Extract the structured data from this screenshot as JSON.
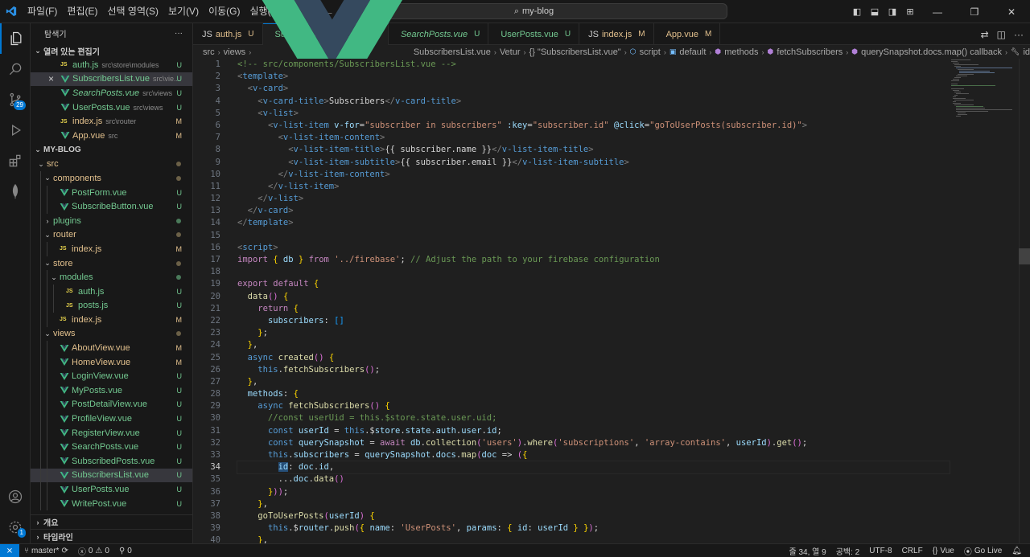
{
  "menu": [
    "파일(F)",
    "편집(E)",
    "선택 영역(S)",
    "보기(V)",
    "이동(G)",
    "실행(R)",
    "···"
  ],
  "search": {
    "label": "my-blog"
  },
  "explorer": {
    "title": "탐색기",
    "open_editors_label": "열려 있는 편집기",
    "open_editors": [
      {
        "kind": "js",
        "name": "auth.js",
        "path": "src\\store\\modules",
        "status": "U"
      },
      {
        "kind": "vue",
        "name": "SubscribersList.vue",
        "path": "src\\vie...",
        "status": "U",
        "close": "×"
      },
      {
        "kind": "vue",
        "name": "SearchPosts.vue",
        "path": "src\\views",
        "status": "U"
      },
      {
        "kind": "vue",
        "name": "UserPosts.vue",
        "path": "src\\views",
        "status": "U"
      },
      {
        "kind": "js",
        "name": "index.js",
        "path": "src\\router",
        "status": "M"
      },
      {
        "kind": "vue",
        "name": "App.vue",
        "path": "src",
        "status": "M"
      }
    ],
    "project_label": "MY-BLOG",
    "tree": [
      {
        "kind": "folder",
        "name": "src",
        "depth": 1,
        "open": true,
        "status": "dot"
      },
      {
        "kind": "folder",
        "name": "components",
        "depth": 2,
        "open": true,
        "status": "dot"
      },
      {
        "kind": "vue",
        "name": "PostForm.vue",
        "depth": 3,
        "status": "U"
      },
      {
        "kind": "vue",
        "name": "SubscribeButton.vue",
        "depth": 3,
        "status": "U"
      },
      {
        "kind": "folder",
        "name": "plugins",
        "depth": 2,
        "open": false,
        "status": "dotg"
      },
      {
        "kind": "folder",
        "name": "router",
        "depth": 2,
        "open": true,
        "status": "dot"
      },
      {
        "kind": "js",
        "name": "index.js",
        "depth": 3,
        "status": "M"
      },
      {
        "kind": "folder",
        "name": "store",
        "depth": 2,
        "open": true,
        "status": "dot"
      },
      {
        "kind": "folder",
        "name": "modules",
        "depth": 3,
        "open": true,
        "status": "dotg"
      },
      {
        "kind": "js",
        "name": "auth.js",
        "depth": 4,
        "status": "U"
      },
      {
        "kind": "js",
        "name": "posts.js",
        "depth": 4,
        "status": "U"
      },
      {
        "kind": "js",
        "name": "index.js",
        "depth": 3,
        "status": "M"
      },
      {
        "kind": "folder",
        "name": "views",
        "depth": 2,
        "open": true,
        "status": "dot"
      },
      {
        "kind": "vue",
        "name": "AboutView.vue",
        "depth": 3,
        "status": "M"
      },
      {
        "kind": "vue",
        "name": "HomeView.vue",
        "depth": 3,
        "status": "M"
      },
      {
        "kind": "vue",
        "name": "LoginView.vue",
        "depth": 3,
        "status": "U"
      },
      {
        "kind": "vue",
        "name": "MyPosts.vue",
        "depth": 3,
        "status": "U"
      },
      {
        "kind": "vue",
        "name": "PostDetailView.vue",
        "depth": 3,
        "status": "U"
      },
      {
        "kind": "vue",
        "name": "ProfileView.vue",
        "depth": 3,
        "status": "U"
      },
      {
        "kind": "vue",
        "name": "RegisterView.vue",
        "depth": 3,
        "status": "U"
      },
      {
        "kind": "vue",
        "name": "SearchPosts.vue",
        "depth": 3,
        "status": "U"
      },
      {
        "kind": "vue",
        "name": "SubscribedPosts.vue",
        "depth": 3,
        "status": "U"
      },
      {
        "kind": "vue",
        "name": "SubscribersList.vue",
        "depth": 3,
        "status": "U",
        "selected": true
      },
      {
        "kind": "vue",
        "name": "UserPosts.vue",
        "depth": 3,
        "status": "U"
      },
      {
        "kind": "vue",
        "name": "WritePost.vue",
        "depth": 3,
        "status": "U"
      }
    ],
    "outline_label": "개요",
    "timeline_label": "타임라인"
  },
  "tabs": [
    {
      "kind": "js",
      "name": "auth.js",
      "mark": "U",
      "color": "yellow"
    },
    {
      "kind": "vue",
      "name": "SubscribersList.vue",
      "mark": "U",
      "color": "green",
      "active": true
    },
    {
      "kind": "vue",
      "name": "SearchPosts.vue",
      "mark": "U",
      "color": "green",
      "italic": true
    },
    {
      "kind": "vue",
      "name": "UserPosts.vue",
      "mark": "U",
      "color": "green"
    },
    {
      "kind": "js",
      "name": "index.js",
      "mark": "M",
      "color": "yellow"
    },
    {
      "kind": "vue",
      "name": "App.vue",
      "mark": "M",
      "color": "yellow"
    }
  ],
  "breadcrumb": [
    "src",
    "views",
    "SubscribersList.vue",
    "Vetur",
    "{} \"SubscribersList.vue\"",
    "script",
    "default",
    "methods",
    "fetchSubscribers",
    "querySnapshot.docs.map() callback",
    "id"
  ],
  "editor": {
    "current_line": 34,
    "lines": [
      "<!-- src/components/SubscribersList.vue -->",
      "<template>",
      "  <v-card>",
      "    <v-card-title>Subscribers</v-card-title>",
      "    <v-list>",
      "      <v-list-item v-for=\"subscriber in subscribers\" :key=\"subscriber.id\" @click=\"goToUserPosts(subscriber.id)\">",
      "        <v-list-item-content>",
      "          <v-list-item-title>{{ subscriber.name }}</v-list-item-title>",
      "          <v-list-item-subtitle>{{ subscriber.email }}</v-list-item-subtitle>",
      "        </v-list-item-content>",
      "      </v-list-item>",
      "    </v-list>",
      "  </v-card>",
      "</template>",
      "",
      "<script>",
      "import { db } from '../firebase'; // Adjust the path to your firebase configuration",
      "",
      "export default {",
      "  data() {",
      "    return {",
      "      subscribers: []",
      "    };",
      "  },",
      "  async created() {",
      "    this.fetchSubscribers();",
      "  },",
      "  methods: {",
      "    async fetchSubscribers() {",
      "      //const userUid = this.$store.state.user.uid;",
      "      const userId = this.$store.state.auth.user.id;",
      "      const querySnapshot = await db.collection('users').where('subscriptions', 'array-contains', userId).get();",
      "      this.subscribers = querySnapshot.docs.map(doc => ({",
      "        id: doc.id,",
      "        ...doc.data()",
      "      }));",
      "    },",
      "    goToUserPosts(userId) {",
      "      this.$router.push({ name: 'UserPosts', params: { id: userId } });",
      "    },"
    ]
  },
  "status": {
    "branch": "master*",
    "errors": "0",
    "warnings": "0",
    "ports": "0",
    "position": "줄 34, 열 9",
    "spaces": "공백: 2",
    "encoding": "UTF-8",
    "eol": "CRLF",
    "language": "Vue",
    "golive": "Go Live"
  },
  "activity_badge": "29",
  "account_badge": "1"
}
